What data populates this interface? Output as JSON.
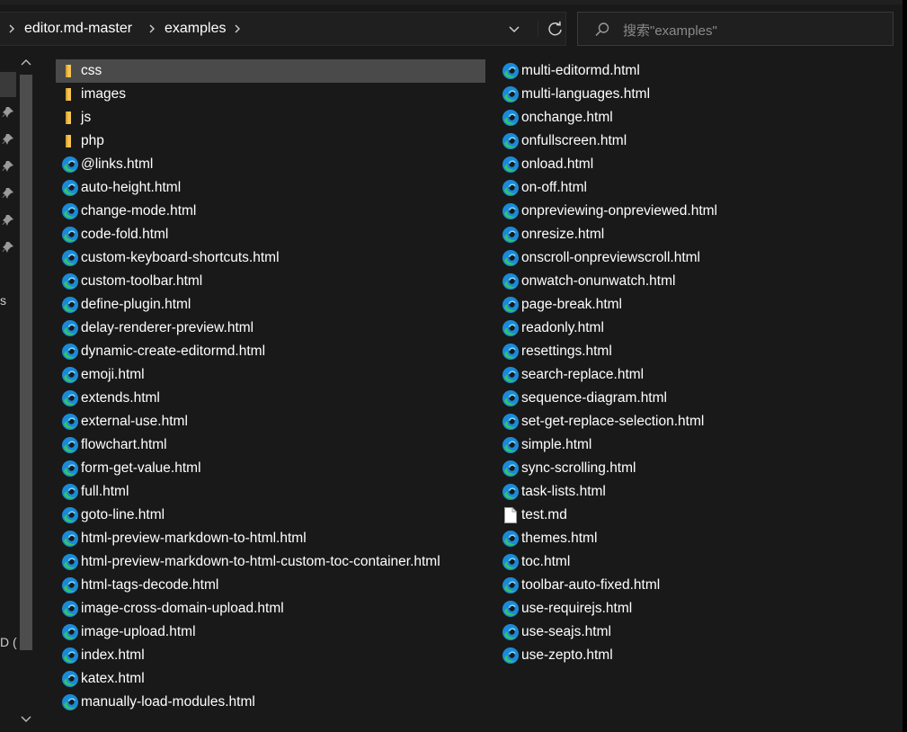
{
  "breadcrumb": [
    "editor.md-master",
    "examples"
  ],
  "search": {
    "placeholder": "搜索\"examples\""
  },
  "nav": {
    "fragments": [
      "s",
      "D ("
    ]
  },
  "colors": {
    "folder": "#f5c451",
    "edge_blue": "#1a8ad8",
    "edge_green": "#35c16a",
    "background": "#191919"
  },
  "files": {
    "column1": [
      {
        "name": "css",
        "type": "folder",
        "selected": true
      },
      {
        "name": "images",
        "type": "folder"
      },
      {
        "name": "js",
        "type": "folder"
      },
      {
        "name": "php",
        "type": "folder"
      },
      {
        "name": "@links.html",
        "type": "html"
      },
      {
        "name": "auto-height.html",
        "type": "html"
      },
      {
        "name": "change-mode.html",
        "type": "html"
      },
      {
        "name": "code-fold.html",
        "type": "html"
      },
      {
        "name": "custom-keyboard-shortcuts.html",
        "type": "html"
      },
      {
        "name": "custom-toolbar.html",
        "type": "html"
      },
      {
        "name": "define-plugin.html",
        "type": "html"
      },
      {
        "name": "delay-renderer-preview.html",
        "type": "html"
      },
      {
        "name": "dynamic-create-editormd.html",
        "type": "html"
      },
      {
        "name": "emoji.html",
        "type": "html"
      },
      {
        "name": "extends.html",
        "type": "html"
      },
      {
        "name": "external-use.html",
        "type": "html"
      },
      {
        "name": "flowchart.html",
        "type": "html"
      },
      {
        "name": "form-get-value.html",
        "type": "html"
      },
      {
        "name": "full.html",
        "type": "html"
      },
      {
        "name": "goto-line.html",
        "type": "html"
      },
      {
        "name": "html-preview-markdown-to-html.html",
        "type": "html"
      },
      {
        "name": "html-preview-markdown-to-html-custom-toc-container.html",
        "type": "html"
      },
      {
        "name": "html-tags-decode.html",
        "type": "html"
      },
      {
        "name": "image-cross-domain-upload.html",
        "type": "html"
      },
      {
        "name": "image-upload.html",
        "type": "html"
      },
      {
        "name": "index.html",
        "type": "html"
      },
      {
        "name": "katex.html",
        "type": "html"
      },
      {
        "name": "manually-load-modules.html",
        "type": "html"
      }
    ],
    "column2": [
      {
        "name": "multi-editormd.html",
        "type": "html"
      },
      {
        "name": "multi-languages.html",
        "type": "html"
      },
      {
        "name": "onchange.html",
        "type": "html"
      },
      {
        "name": "onfullscreen.html",
        "type": "html"
      },
      {
        "name": "onload.html",
        "type": "html"
      },
      {
        "name": "on-off.html",
        "type": "html"
      },
      {
        "name": "onpreviewing-onpreviewed.html",
        "type": "html"
      },
      {
        "name": "onresize.html",
        "type": "html"
      },
      {
        "name": "onscroll-onpreviewscroll.html",
        "type": "html"
      },
      {
        "name": "onwatch-onunwatch.html",
        "type": "html"
      },
      {
        "name": "page-break.html",
        "type": "html"
      },
      {
        "name": "readonly.html",
        "type": "html"
      },
      {
        "name": "resettings.html",
        "type": "html"
      },
      {
        "name": "search-replace.html",
        "type": "html"
      },
      {
        "name": "sequence-diagram.html",
        "type": "html"
      },
      {
        "name": "set-get-replace-selection.html",
        "type": "html"
      },
      {
        "name": "simple.html",
        "type": "html"
      },
      {
        "name": "sync-scrolling.html",
        "type": "html"
      },
      {
        "name": "task-lists.html",
        "type": "html"
      },
      {
        "name": "test.md",
        "type": "file"
      },
      {
        "name": "themes.html",
        "type": "html"
      },
      {
        "name": "toc.html",
        "type": "html"
      },
      {
        "name": "toolbar-auto-fixed.html",
        "type": "html"
      },
      {
        "name": "use-requirejs.html",
        "type": "html"
      },
      {
        "name": "use-seajs.html",
        "type": "html"
      },
      {
        "name": "use-zepto.html",
        "type": "html"
      }
    ]
  }
}
